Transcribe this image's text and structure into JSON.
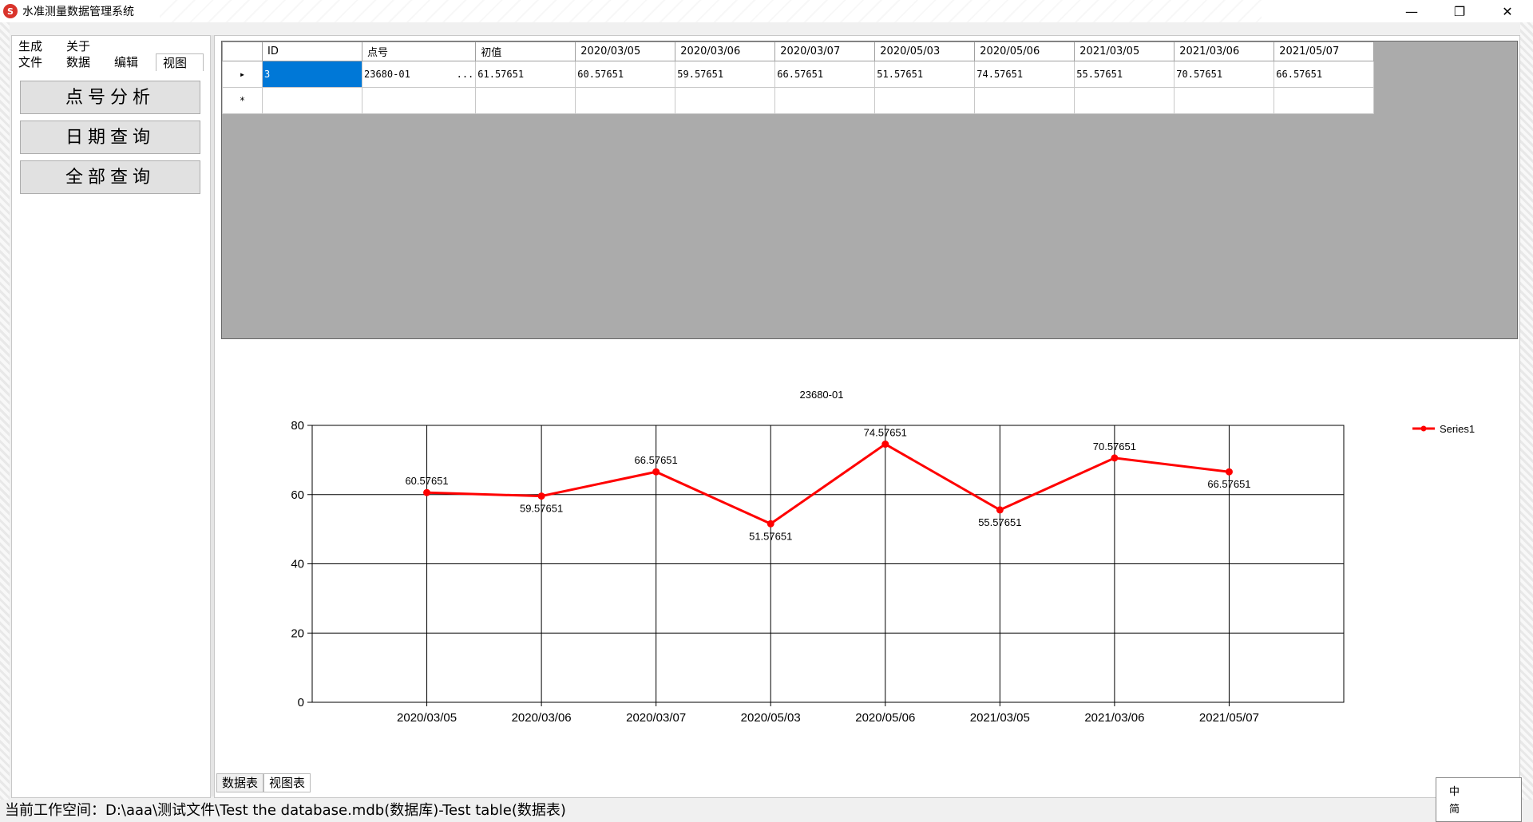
{
  "window": {
    "title": "水准测量数据管理系统",
    "app_icon_label": "S",
    "minimize": "—",
    "maximize": "❐",
    "close": "✕"
  },
  "menu": {
    "row1": [
      "生成",
      "关于"
    ],
    "row2": [
      "文件",
      "数据",
      "编辑",
      "视图"
    ]
  },
  "buttons": {
    "point_analysis": "点号分析",
    "date_query": "日期查询",
    "all_query": "全部查询"
  },
  "grid": {
    "columns": [
      "ID",
      "点号",
      "初值",
      "2020/03/05",
      "2020/03/06",
      "2020/03/07",
      "2020/05/03",
      "2020/05/06",
      "2021/03/05",
      "2021/03/06",
      "2021/05/07"
    ],
    "rows": [
      [
        "3",
        "23680-01        ...",
        "61.57651",
        "60.57651",
        "59.57651",
        "66.57651",
        "51.57651",
        "74.57651",
        "55.57651",
        "70.57651",
        "66.57651"
      ]
    ],
    "current_row_marker": "▸",
    "new_row_marker": "*"
  },
  "chart_data": {
    "type": "line",
    "title": "23680-01",
    "categories": [
      "2020/03/05",
      "2020/03/06",
      "2020/03/07",
      "2020/05/03",
      "2020/05/06",
      "2021/03/05",
      "2021/03/06",
      "2021/05/07"
    ],
    "series": [
      {
        "name": "Series1",
        "color": "#ff0000",
        "values": [
          60.57651,
          59.57651,
          66.57651,
          51.57651,
          74.57651,
          55.57651,
          70.57651,
          66.57651
        ]
      }
    ],
    "yticks": [
      0,
      20,
      40,
      60,
      80
    ],
    "ylim": [
      0,
      80
    ],
    "grid": true,
    "legend": "top-right",
    "data_labels": true
  },
  "tabs": [
    "数据表",
    "视图表"
  ],
  "status": {
    "text": "当前工作空间：D:\\aaa\\测试文件\\Test the database.mdb(数据库)-Test table(数据表)"
  },
  "ime": {
    "chars": [
      "中",
      "简"
    ]
  }
}
